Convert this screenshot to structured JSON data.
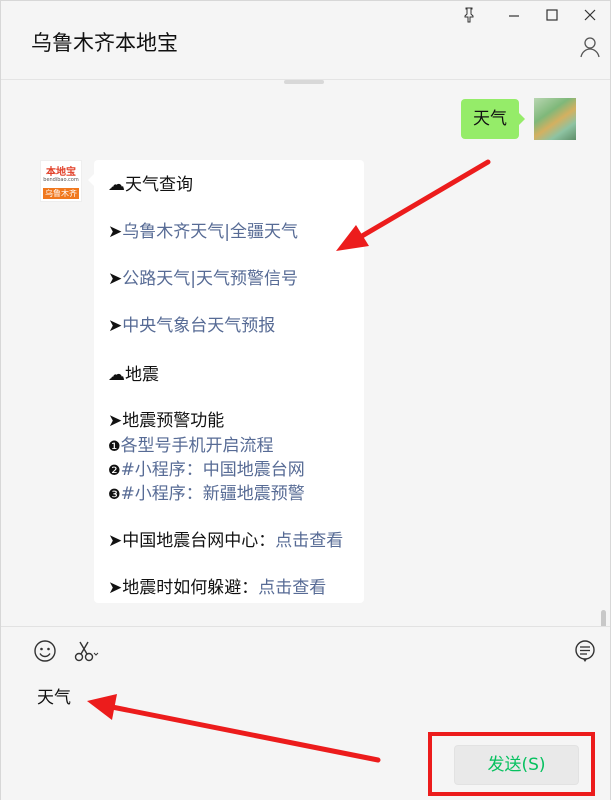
{
  "window": {
    "title": "乌鲁木齐本地宝",
    "controls": [
      "pin-icon",
      "minimize-icon",
      "maximize-icon",
      "close-icon"
    ]
  },
  "chat": {
    "sent_message": "天气",
    "bot": {
      "avatar_logo_text": "本地宝",
      "avatar_logo_url": "bendibao.com",
      "avatar_logo_city": "乌鲁木齐",
      "lines": [
        {
          "prefix": "☁",
          "text": "天气查询",
          "link": false
        },
        {
          "prefix": "➤",
          "text": "乌鲁木齐天气|全疆天气",
          "link": true
        },
        {
          "prefix": "➤",
          "text": "公路天气|天气预警信号",
          "link": true
        },
        {
          "prefix": "➤",
          "text": "中央气象台天气预报",
          "link": true
        },
        {
          "prefix": "☁",
          "text": "地震",
          "link": false
        },
        {
          "prefix": "➤",
          "text": "地震预警功能",
          "link": false
        },
        {
          "prefix": "❶",
          "text": "各型号手机开启流程",
          "link": true
        },
        {
          "prefix": "❷",
          "text": "#小程序：中国地震台网",
          "link": true
        },
        {
          "prefix": "❸",
          "text": "#小程序：新疆地震预警",
          "link": true
        },
        {
          "prefix": "➤",
          "text": "中国地震台网中心：",
          "link": false,
          "link_text": "点击查看"
        },
        {
          "prefix": "➤",
          "text": "地震时如何躲避：",
          "link": false,
          "link_text": "点击查看"
        }
      ]
    }
  },
  "input": {
    "text": "天气",
    "send_label": "发送(S)",
    "tools": [
      "emoji-icon",
      "scissors-icon",
      "chat-history-icon"
    ]
  },
  "colors": {
    "sent_bubble": "#95ec69",
    "link": "#576b95",
    "send_text": "#07c160",
    "annotation_red": "#ec1c1c"
  }
}
